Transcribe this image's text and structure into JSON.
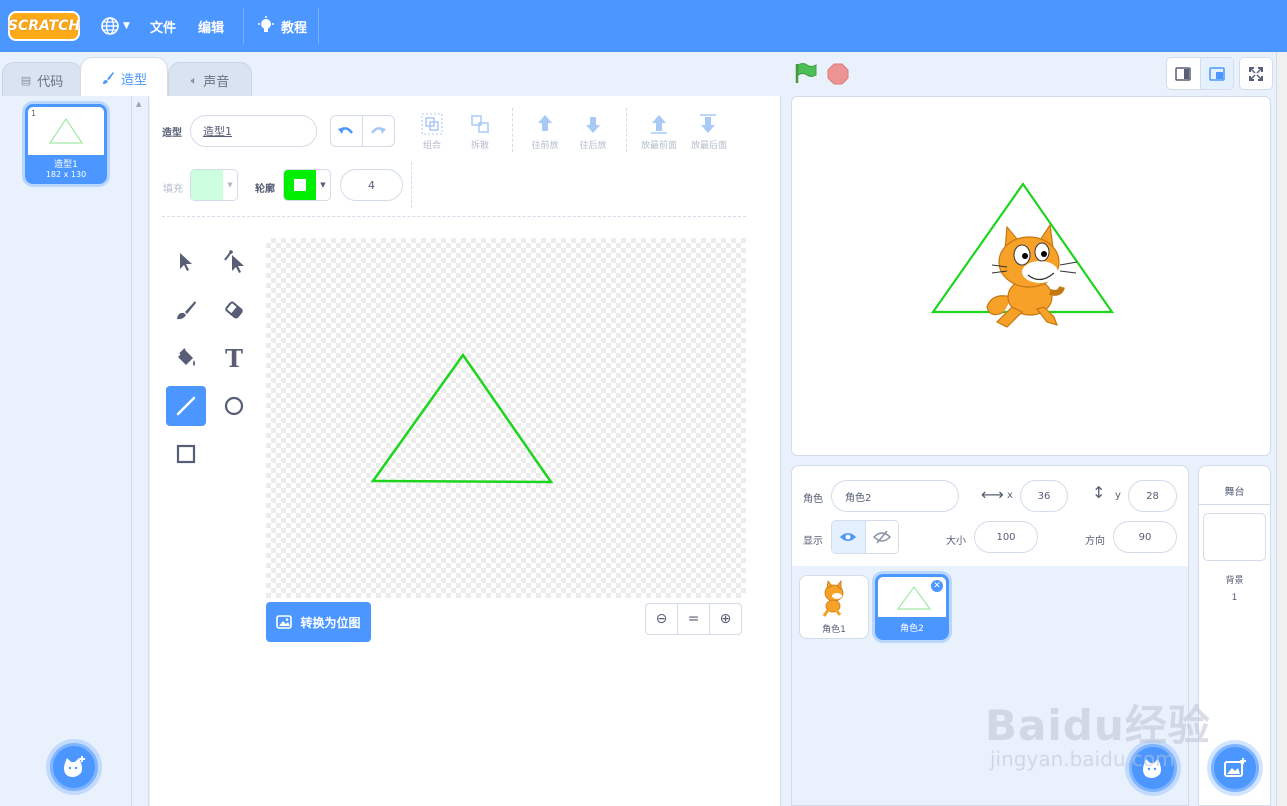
{
  "menubar": {
    "logo": "SCRATCH",
    "file": "文件",
    "edit": "编辑",
    "tutorials": "教程"
  },
  "tabs": {
    "code": "代码",
    "costumes": "造型",
    "sounds": "声音"
  },
  "costume_list": {
    "items": [
      {
        "num": "1",
        "name": "造型1",
        "dims": "182 x 130"
      }
    ]
  },
  "editor": {
    "costume_label": "造型",
    "costume_name": "造型1",
    "group": "组合",
    "ungroup": "拆散",
    "forward": "往前放",
    "backward": "往后放",
    "front": "放最前面",
    "back": "放最后面",
    "fill_label": "填充",
    "outline_label": "轮廓",
    "outline_width": "4",
    "convert_button": "转换为位图",
    "zoom_out": "⊖",
    "zoom_reset": "=",
    "zoom_in": "⊕"
  },
  "sprite_info": {
    "sprite_label": "角色",
    "sprite_name": "角色2",
    "x_label": "x",
    "x_value": "36",
    "y_label": "y",
    "y_value": "28",
    "show_label": "显示",
    "size_label": "大小",
    "size_value": "100",
    "direction_label": "方向",
    "direction_value": "90"
  },
  "sprites": [
    {
      "name": "角色1"
    },
    {
      "name": "角色2"
    }
  ],
  "stage_panel": {
    "title": "舞台",
    "backdrops_label": "背景",
    "backdrops_count": "1"
  },
  "watermark": {
    "brand": "Baidu经验",
    "url": "jingyan.baidu.com"
  },
  "colors": {
    "accent": "#4c97ff",
    "green_line": "#1fd41f",
    "fill": "#ccffdd",
    "outline": "#00ee00"
  }
}
